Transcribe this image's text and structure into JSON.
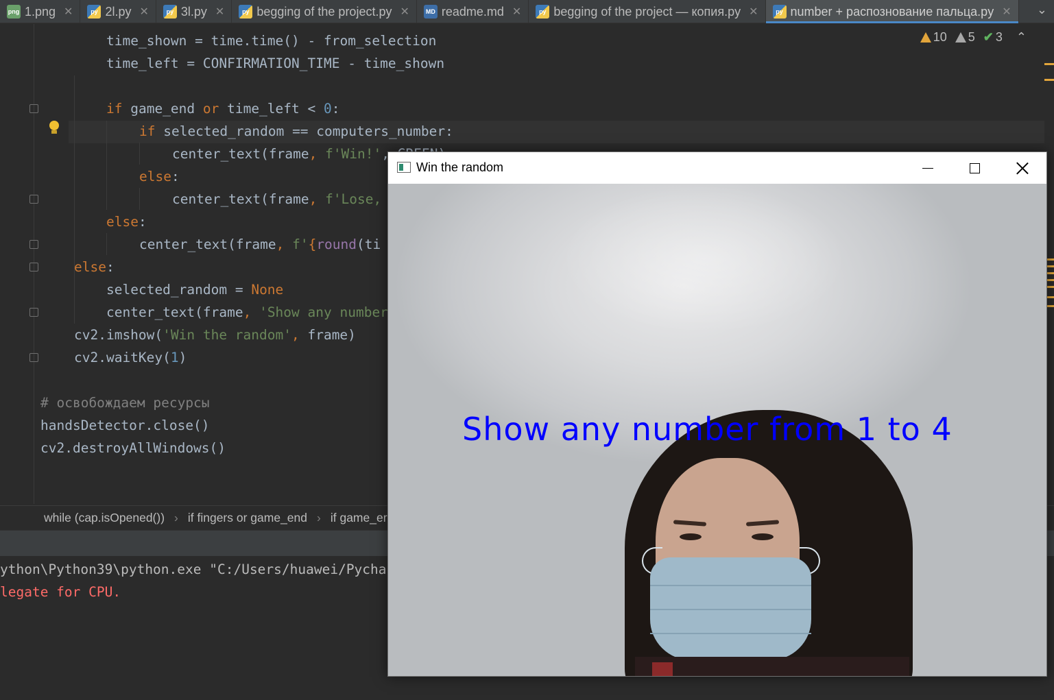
{
  "tabs": [
    {
      "label": "1.png",
      "type": "png",
      "active": false
    },
    {
      "label": "2l.py",
      "type": "py",
      "active": false
    },
    {
      "label": "3l.py",
      "type": "py",
      "active": false
    },
    {
      "label": "begging of the project.py",
      "type": "py",
      "active": false
    },
    {
      "label": "readme.md",
      "type": "md",
      "active": false
    },
    {
      "label": "begging of the project — копия.py",
      "type": "py",
      "active": false
    },
    {
      "label": "number + распознование пальца.py",
      "type": "py",
      "active": true
    }
  ],
  "tab_close_glyph": "✕",
  "tab_icon_text": {
    "py": "py",
    "md": "MD",
    "png": "png"
  },
  "inspections": {
    "warnings": "10",
    "weak_warnings": "5",
    "typos": "3"
  },
  "code_lines": [
    {
      "indent": 1,
      "tokens": [
        [
          "time_shown = time.time() - from_selection",
          ""
        ]
      ]
    },
    {
      "indent": 1,
      "tokens": [
        [
          "time_left = ",
          ""
        ],
        [
          "CONFIRMATION_TIME",
          ""
        ],
        [
          " - time_shown",
          ""
        ]
      ]
    },
    {
      "indent": 1,
      "tokens": []
    },
    {
      "indent": 1,
      "tokens": [
        [
          "if",
          "kw"
        ],
        [
          " game_end ",
          ""
        ],
        [
          "or",
          "kw"
        ],
        [
          " time_left < ",
          ""
        ],
        [
          "0",
          "num"
        ],
        [
          ":",
          ""
        ]
      ]
    },
    {
      "indent": 2,
      "tokens": [
        [
          "if",
          "kw"
        ],
        [
          " selected_random == computers_number:",
          ""
        ]
      ]
    },
    {
      "indent": 3,
      "tokens": [
        [
          "center_text(frame",
          ""
        ],
        [
          ", ",
          "kw"
        ],
        [
          "f'Win!'",
          "str"
        ],
        [
          ", GREEN)",
          ""
        ]
      ]
    },
    {
      "indent": 2,
      "tokens": [
        [
          "else",
          "kw"
        ],
        [
          ":",
          ""
        ]
      ]
    },
    {
      "indent": 3,
      "tokens": [
        [
          "center_text(frame",
          ""
        ],
        [
          ", ",
          "kw"
        ],
        [
          "f'Lose, ",
          "str"
        ]
      ]
    },
    {
      "indent": 1,
      "tokens": [
        [
          "else",
          "kw"
        ],
        [
          ":",
          ""
        ]
      ]
    },
    {
      "indent": 2,
      "tokens": [
        [
          "center_text(frame",
          ""
        ],
        [
          ", ",
          "kw"
        ],
        [
          "f'",
          "str"
        ],
        [
          "{",
          "brace"
        ],
        [
          "round",
          "const"
        ],
        [
          "(ti",
          ""
        ]
      ]
    },
    {
      "indent": 0,
      "tokens": [
        [
          "else",
          "kw"
        ],
        [
          ":",
          ""
        ]
      ]
    },
    {
      "indent": 1,
      "tokens": [
        [
          "selected_random = ",
          ""
        ],
        [
          "None",
          "none"
        ]
      ]
    },
    {
      "indent": 1,
      "tokens": [
        [
          "center_text(frame",
          ""
        ],
        [
          ", ",
          "kw"
        ],
        [
          "'Show any number",
          "str"
        ]
      ]
    },
    {
      "indent": 0,
      "tokens": [
        [
          "cv2.imshow(",
          ""
        ],
        [
          "'Win the random'",
          "str"
        ],
        [
          ", ",
          "kw"
        ],
        [
          "frame)",
          ""
        ]
      ]
    },
    {
      "indent": 0,
      "tokens": [
        [
          "cv2.waitKey(",
          ""
        ],
        [
          "1",
          "num"
        ],
        [
          ")",
          ""
        ]
      ]
    },
    {
      "indent": -1,
      "tokens": []
    },
    {
      "indent": -1,
      "tokens": [
        [
          "# освобождаем ресурсы",
          "cmt"
        ]
      ]
    },
    {
      "indent": -1,
      "tokens": [
        [
          "handsDetector.close()",
          ""
        ]
      ]
    },
    {
      "indent": -1,
      "tokens": [
        [
          "cv2.destroyAllWindows()",
          ""
        ]
      ]
    }
  ],
  "breadcrumbs": [
    "while (cap.isOpened())",
    "if fingers or game_end",
    "if game_er"
  ],
  "breadcrumb_separator": "›",
  "console_lines": [
    {
      "text": "ython\\Python39\\python.exe \"C:/Users/huawei/Pycha",
      "kind": "plain"
    },
    {
      "text": "legate for CPU.",
      "kind": "err"
    }
  ],
  "cv_window": {
    "title": "Win the random",
    "overlay_text": "Show any number from 1 to 4",
    "overlay_color": "#0000ff"
  },
  "colors": {
    "keyword": "#cc7832",
    "string": "#6a8759",
    "number": "#6897bb",
    "comment": "#808080",
    "error": "#ff6b68",
    "accent": "#4a88c7"
  }
}
